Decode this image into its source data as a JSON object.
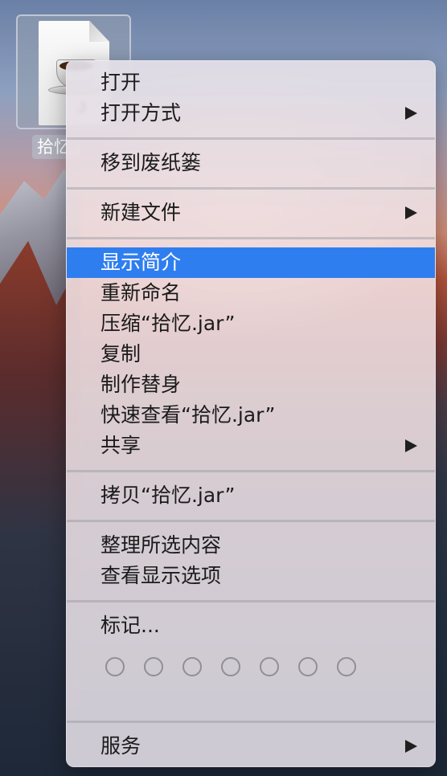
{
  "desktop": {
    "file": {
      "badge_text": "J",
      "caption": "拾忆.jar"
    }
  },
  "menu": {
    "items": {
      "open": "打开",
      "open_with": "打开方式",
      "move_to_trash": "移到废纸篓",
      "new_file": "新建文件",
      "get_info": "显示简介",
      "rename": "重新命名",
      "compress": "压缩“拾忆.jar”",
      "duplicate": "复制",
      "make_alias": "制作替身",
      "quick_look": "快速查看“拾忆.jar”",
      "share": "共享",
      "copy": "拷贝“拾忆.jar”",
      "clean_up": "整理所选内容",
      "view_options": "查看显示选项",
      "tags": "标记...",
      "services": "服务"
    },
    "highlighted_item": "显示简介",
    "tag_colors": [
      "none",
      "none",
      "none",
      "none",
      "none",
      "none",
      "none"
    ],
    "accent_color": "#2f7ef0"
  }
}
